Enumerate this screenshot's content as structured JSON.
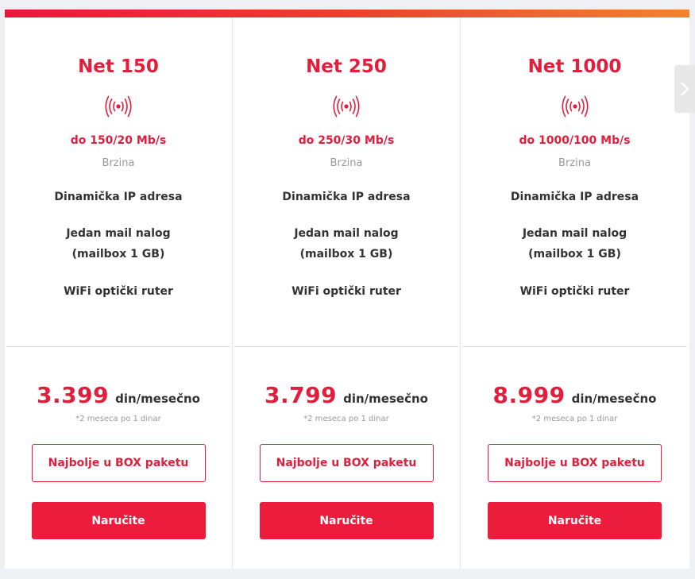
{
  "plans": [
    {
      "name": "Net 150",
      "icon": "wifi-signal-icon",
      "speed": "do 150/20 Mb/s",
      "speed_label": "Brzina",
      "features": [
        "Dinamička IP adresa",
        "Jedan mail nalog (mailbox 1 GB)",
        "WiFi optički ruter"
      ],
      "price": "3.399",
      "unit": "din/mesečno",
      "note": "*2 meseca po 1 dinar",
      "box_label": "Najbolje u BOX paketu",
      "order_label": "Naručite"
    },
    {
      "name": "Net 250",
      "icon": "wifi-signal-icon",
      "speed": "do 250/30 Mb/s",
      "speed_label": "Brzina",
      "features": [
        "Dinamička IP adresa",
        "Jedan mail nalog (mailbox 1 GB)",
        "WiFi optički ruter"
      ],
      "price": "3.799",
      "unit": "din/mesečno",
      "note": "*2 meseca po 1 dinar",
      "box_label": "Najbolje u BOX paketu",
      "order_label": "Naručite"
    },
    {
      "name": "Net 1000",
      "icon": "wifi-signal-icon",
      "speed": "do 1000/100 Mb/s",
      "speed_label": "Brzina",
      "features": [
        "Dinamička IP adresa",
        "Jedan mail nalog (mailbox 1 GB)",
        "WiFi optički ruter"
      ],
      "price": "8.999",
      "unit": "din/mesečno",
      "note": "*2 meseca po 1 dinar",
      "box_label": "Najbolje u BOX paketu",
      "order_label": "Naručite"
    }
  ],
  "carousel": {
    "next_icon": "chevron-right-icon"
  },
  "colors": {
    "accent": "#e31e3c",
    "button": "#ec1c3c",
    "gradient_start": "#e8173c",
    "gradient_end": "#f3832b"
  }
}
